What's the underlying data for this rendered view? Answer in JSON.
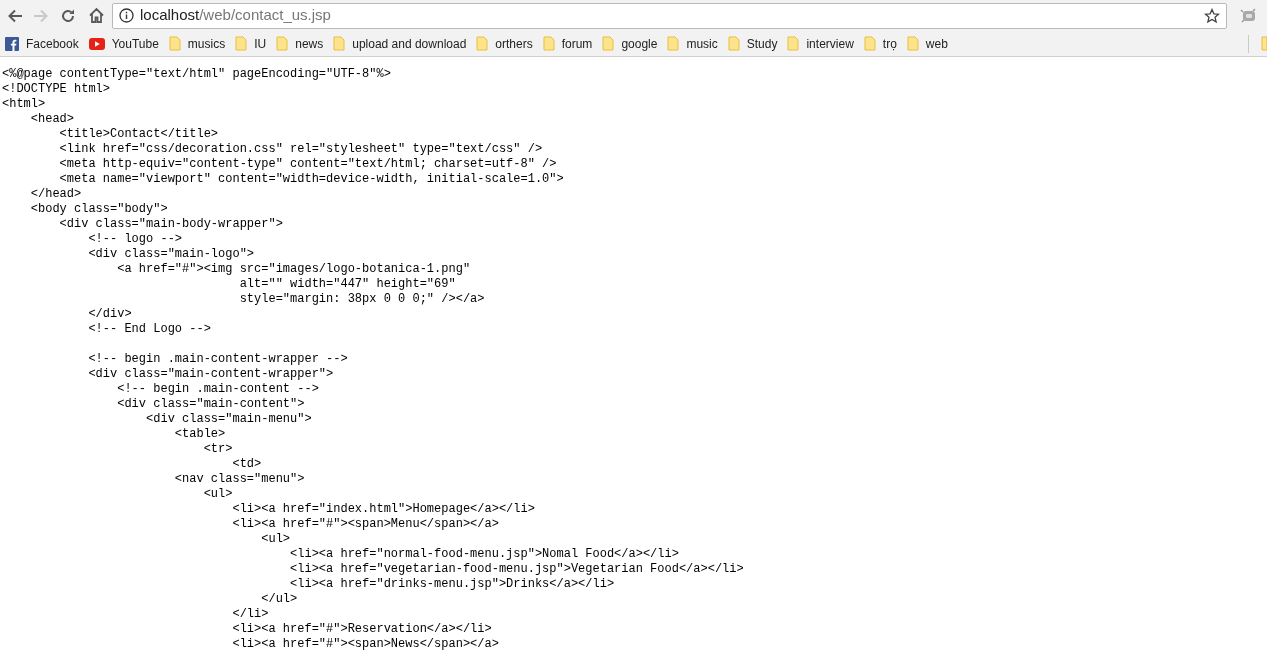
{
  "toolbar": {
    "back_enabled": true,
    "forward_enabled": false,
    "address": {
      "host": "localhost",
      "path": "/web/contact_us.jsp"
    }
  },
  "bookmarks": [
    {
      "kind": "facebook",
      "label": "Facebook"
    },
    {
      "kind": "youtube",
      "label": "YouTube"
    },
    {
      "kind": "folder",
      "label": "musics"
    },
    {
      "kind": "folder",
      "label": "IU"
    },
    {
      "kind": "folder",
      "label": "news"
    },
    {
      "kind": "folder",
      "label": "upload and download"
    },
    {
      "kind": "folder",
      "label": "orthers"
    },
    {
      "kind": "folder",
      "label": "forum"
    },
    {
      "kind": "folder",
      "label": "google"
    },
    {
      "kind": "folder",
      "label": "music"
    },
    {
      "kind": "folder",
      "label": "Study"
    },
    {
      "kind": "folder",
      "label": "interview"
    },
    {
      "kind": "folder",
      "label": "trọ"
    },
    {
      "kind": "folder",
      "label": "web"
    }
  ],
  "source_lines": [
    {
      "text": "<%@page contentType=\"text/html\" pageEncoding=\"UTF-8\"%>"
    },
    {
      "text": "<!DOCTYPE html>"
    },
    {
      "text": "<html>"
    },
    {
      "text": "    <head>"
    },
    {
      "text": "        <title>Contact</title>"
    },
    {
      "text": "        <link href=\"css/decoration.css\" rel=\"stylesheet\" type=\"text/css\" />"
    },
    {
      "text": "        <meta http-equiv=\"content-type\" content=\"text/html; charset=utf-8\" />"
    },
    {
      "text": "        <meta name=\"viewport\" content=\"width=device-width, initial-scale=1.0\">"
    },
    {
      "text": "    </head>"
    },
    {
      "text": "    <body class=\"body\">"
    },
    {
      "text": "        <div class=\"main-body-wrapper\">"
    },
    {
      "text": "            <!-- logo -->"
    },
    {
      "text": "            <div class=\"main-logo\">"
    },
    {
      "text": "                <a href=\"#\"><img src=\"images/logo-botanica-1.png\""
    },
    {
      "text": "                                 alt=\"\" width=\"447\" height=\"69\""
    },
    {
      "text": "                                 style=\"margin: 38px 0 0 0;\" /></a>"
    },
    {
      "text": "            </div>"
    },
    {
      "text": "            <!-- End Logo -->"
    },
    {
      "text": "            <!-- begin .main-content-wrapper -->",
      "blank_before": true
    },
    {
      "text": "            <div class=\"main-content-wrapper\">"
    },
    {
      "text": "                <!-- begin .main-content -->"
    },
    {
      "text": "                <div class=\"main-content\">"
    },
    {
      "text": "                    <div class=\"main-menu\">"
    },
    {
      "text": "                        <table>"
    },
    {
      "text": "                            <tr>"
    },
    {
      "text": "                                <td>"
    },
    {
      "text": "                        <nav class=\"menu\">"
    },
    {
      "text": "                            <ul>"
    },
    {
      "text": "                                <li><a href=\"index.html\">Homepage</a></li>"
    },
    {
      "text": "                                <li><a href=\"#\"><span>Menu</span></a>"
    },
    {
      "text": "                                    <ul>"
    },
    {
      "text": "                                        <li><a href=\"normal-food-menu.jsp\">Nomal Food</a></li>"
    },
    {
      "text": "                                        <li><a href=\"vegetarian-food-menu.jsp\">Vegetarian Food</a></li>"
    },
    {
      "text": "                                        <li><a href=\"drinks-menu.jsp\">Drinks</a></li>"
    },
    {
      "text": "                                    </ul>"
    },
    {
      "text": "                                </li>"
    },
    {
      "text": "                                <li><a href=\"#\">Reservation</a></li>"
    },
    {
      "text": "                                <li><a href=\"#\"><span>News</span></a>"
    }
  ]
}
